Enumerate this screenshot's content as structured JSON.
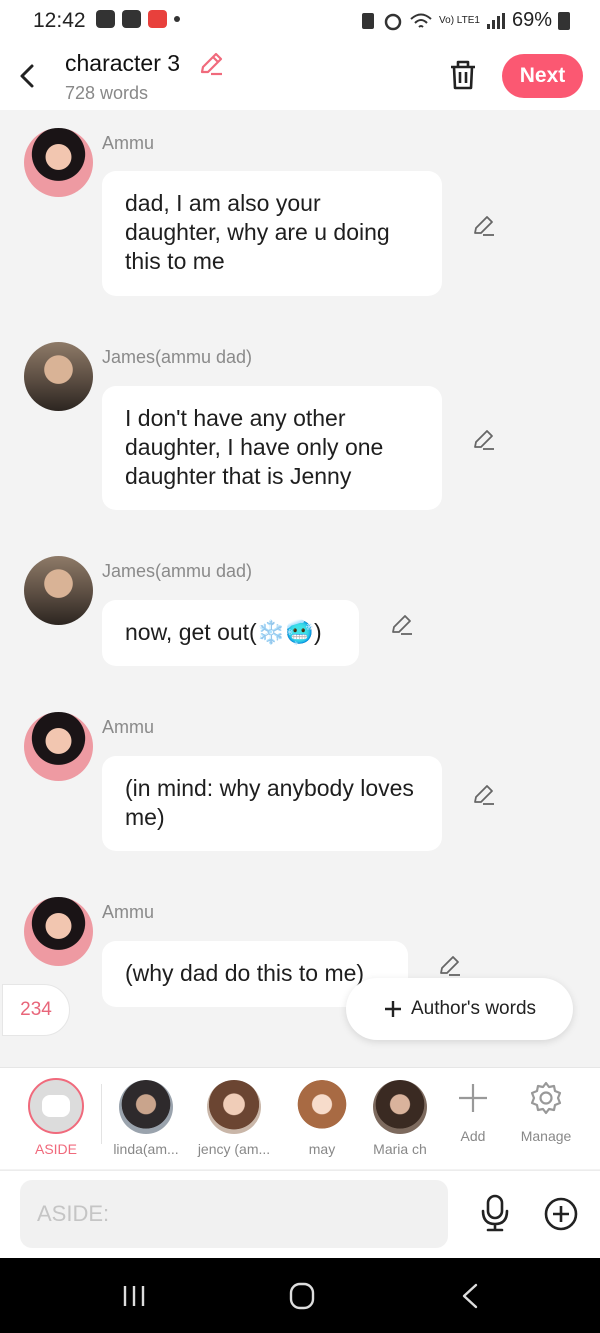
{
  "status_bar": {
    "time": "12:42",
    "battery": "69%",
    "network": "Vo) LTE1"
  },
  "header": {
    "title": "character 3",
    "word_count": "728 words",
    "next_label": "Next"
  },
  "messages": [
    {
      "sender": "Ammu",
      "text": "dad, I am also your daughter, why are u doing this to me"
    },
    {
      "sender": "James(ammu dad)",
      "text": "I don't have any other daughter, I have only one daughter that is Jenny"
    },
    {
      "sender": "James(ammu dad)",
      "text": "now, get out(❄️🥶)"
    },
    {
      "sender": "Ammu",
      "text": "(in mind: why anybody loves me)"
    },
    {
      "sender": "Ammu",
      "text": "(why dad do this to me)"
    }
  ],
  "floating": {
    "counter": "234",
    "authors_words": "Author's words"
  },
  "characters": [
    {
      "label": "ASIDE"
    },
    {
      "label": "linda(am..."
    },
    {
      "label": "jency (am..."
    },
    {
      "label": "may"
    },
    {
      "label": "Maria ch"
    },
    {
      "label": "Add"
    },
    {
      "label": "Manage"
    }
  ],
  "input": {
    "placeholder": "ASIDE:"
  },
  "icons": {
    "back": "chevron-left-icon",
    "title_edit": "pencil-icon",
    "trash": "trash-icon",
    "message_edit": "pencil-icon",
    "mic": "microphone-icon",
    "add": "plus-circle-icon",
    "settings": "gear-icon"
  },
  "colors": {
    "accent": "#fb5872",
    "aside": "#f06a7c",
    "counter": "#e8667a"
  }
}
